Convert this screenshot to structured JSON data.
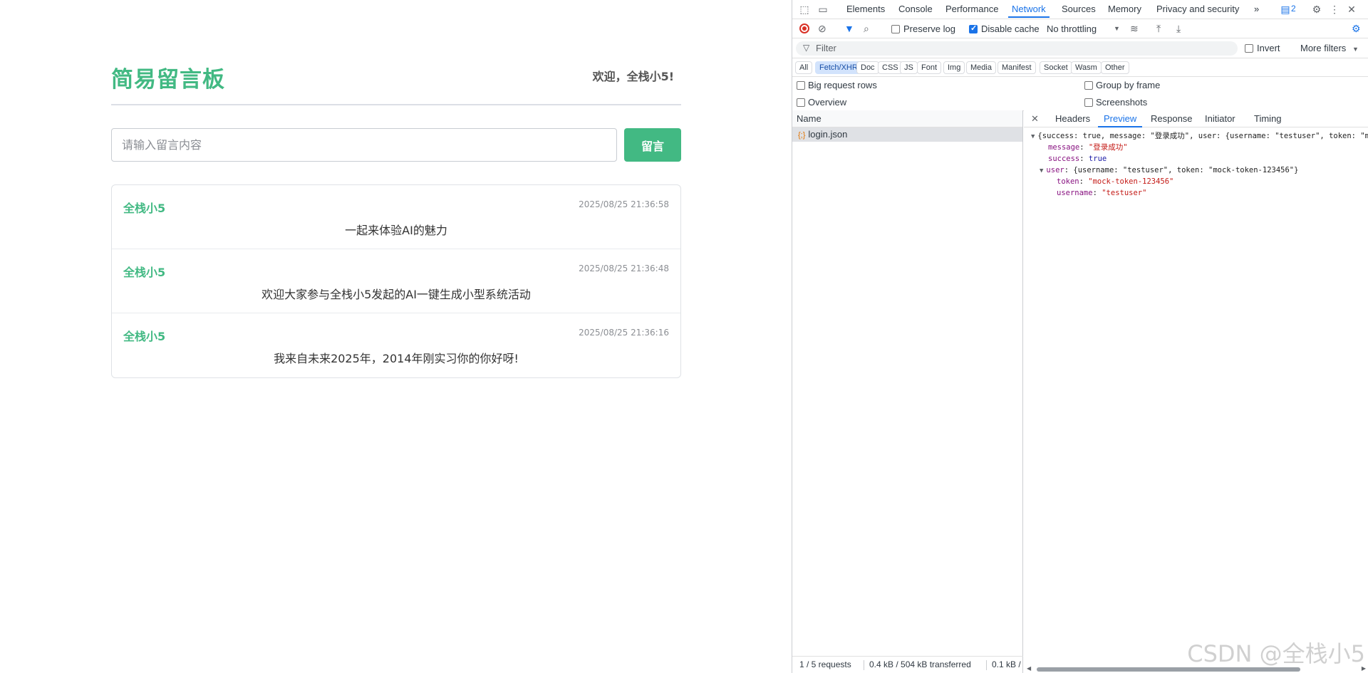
{
  "app": {
    "title": "简易留言板",
    "welcome": "欢迎，全栈小5!",
    "input_placeholder": "请输入留言内容",
    "post_button": "留言",
    "messages": [
      {
        "author": "全栈小5",
        "time": "2025/08/25 21:36:58",
        "content": "一起来体验AI的魅力"
      },
      {
        "author": "全栈小5",
        "time": "2025/08/25 21:36:48",
        "content": "欢迎大家参与全栈小5发起的AI一键生成小型系统活动"
      },
      {
        "author": "全栈小5",
        "time": "2025/08/25 21:36:16",
        "content": "我来自未来2025年，2014年刚实习你的你好呀!"
      }
    ]
  },
  "devtools": {
    "tabs": [
      "Elements",
      "Console",
      "Performance",
      "Network",
      "Sources",
      "Memory",
      "Privacy and security"
    ],
    "active_tab": "Network",
    "more_tabs": "»",
    "issues_count": "2",
    "toolbar": {
      "preserve_log": "Preserve log",
      "disable_cache": "Disable cache",
      "throttling": "No throttling"
    },
    "filter": {
      "placeholder": "Filter",
      "invert": "Invert",
      "more_filters": "More filters"
    },
    "type_filters": [
      "All",
      "Fetch/XHR",
      "Doc",
      "CSS",
      "JS",
      "Font",
      "Img",
      "Media",
      "Manifest",
      "Socket",
      "Wasm",
      "Other"
    ],
    "active_type": "Fetch/XHR",
    "options": {
      "big_request_rows": "Big request rows",
      "group_by_frame": "Group by frame",
      "overview": "Overview",
      "screenshots": "Screenshots"
    },
    "name_column": "Name",
    "request": "login.json",
    "status": {
      "requests": "1 / 5 requests",
      "transferred": "0.4 kB / 504 kB transferred",
      "resources": "0.1 kB /"
    },
    "detail_tabs": [
      "Headers",
      "Preview",
      "Response",
      "Initiator",
      "Timing"
    ],
    "active_detail_tab": "Preview",
    "preview": {
      "summary": "{success: true, message: \"登录成功\", user: {username: \"testuser\", token: \"moc",
      "message_key": "message",
      "message_value": "\"登录成功\"",
      "success_key": "success",
      "success_value": "true",
      "user_key": "user",
      "user_summary": "{username: \"testuser\", token: \"mock-token-123456\"}",
      "token_key": "token",
      "token_value": "\"mock-token-123456\"",
      "username_key": "username",
      "username_value": "\"testuser\""
    },
    "watermark": "CSDN @全栈小5"
  }
}
